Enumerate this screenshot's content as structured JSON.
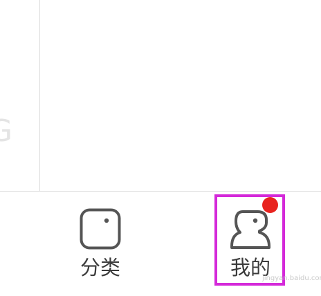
{
  "tab_bar": {
    "tabs": [
      {
        "label": "分类",
        "icon": "category-square-icon"
      },
      {
        "label": "我的",
        "icon": "profile-avatar-icon",
        "has_badge": true
      }
    ]
  },
  "colors": {
    "highlight": "#d429d9",
    "badge": "#e8231f",
    "icon_stroke": "#555555",
    "label_text": "#3a3a3a"
  },
  "watermark": "jingyan.baidu.com"
}
